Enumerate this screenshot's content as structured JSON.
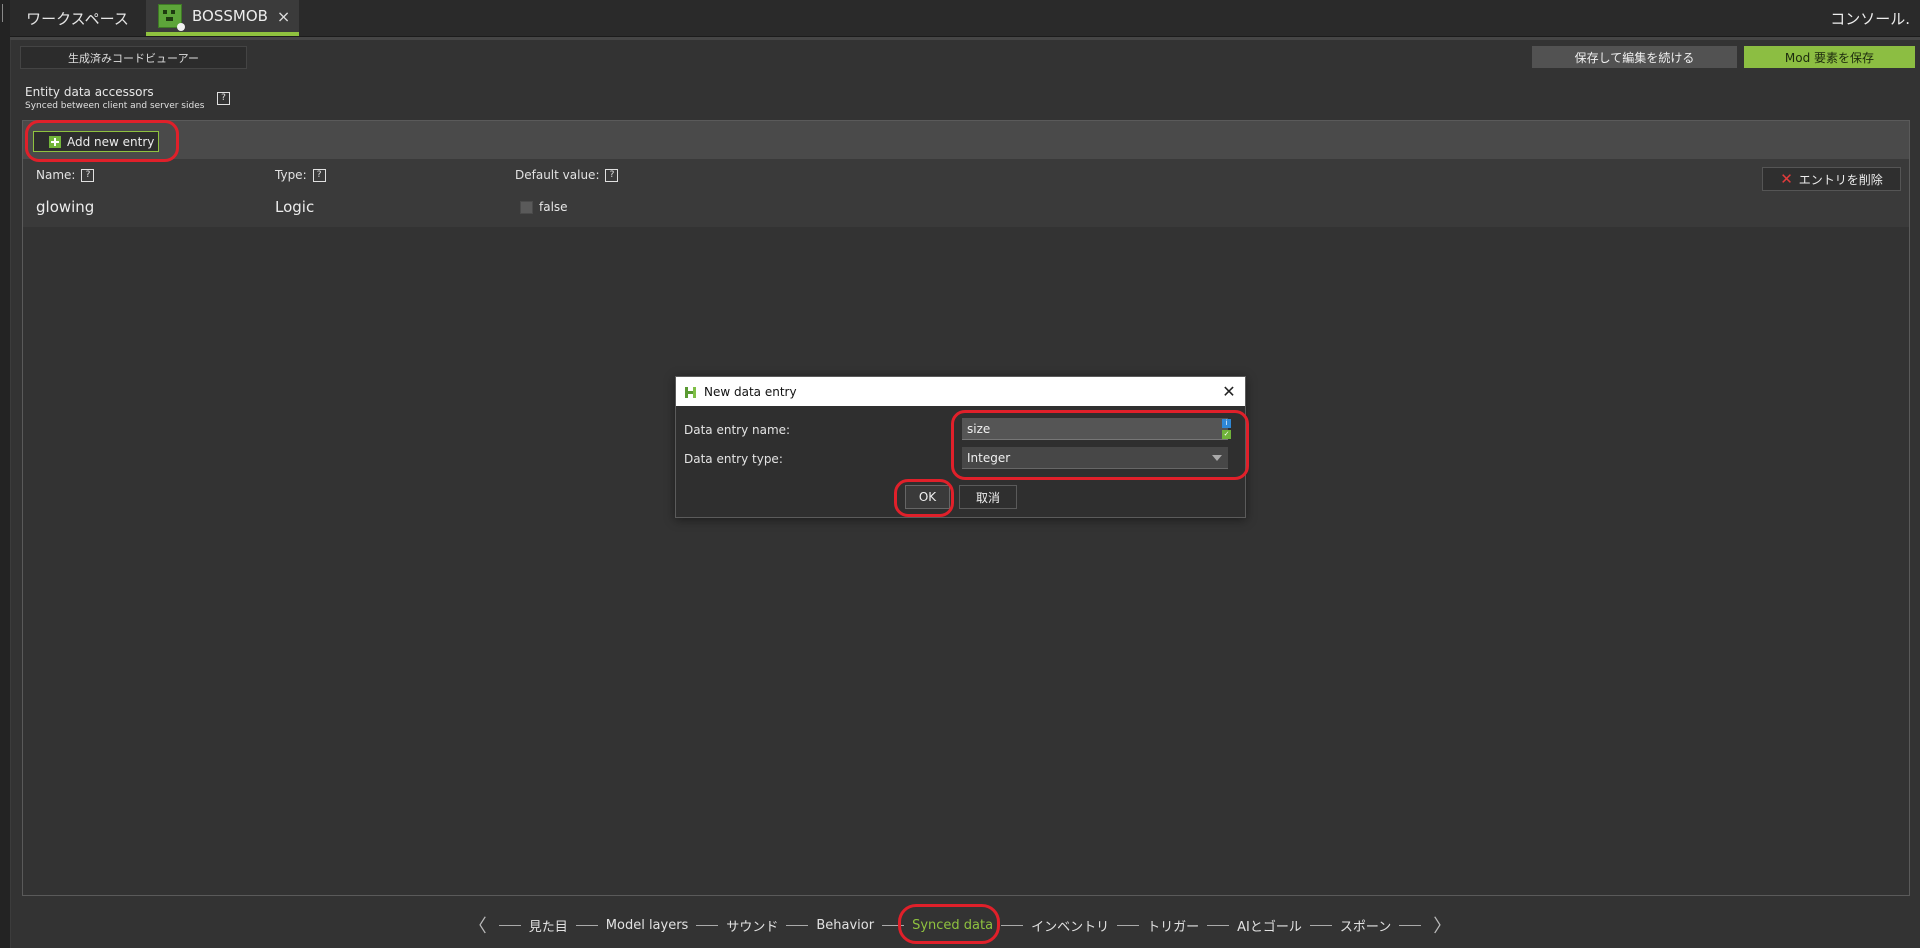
{
  "tabs": {
    "workspace_label": "ワークスペース",
    "mod_tab_label": "BOSSMOB",
    "close_glyph": "×",
    "console_label": "コンソール."
  },
  "toolbar": {
    "code_viewer_label": "生成済みコードビューアー",
    "save_continue_label": "保存して編集を続ける",
    "save_mod_label": "Mod 要素を保存"
  },
  "section": {
    "title": "Entity data accessors",
    "subtitle": "Synced between client and server sides",
    "help_glyph": "?"
  },
  "panel": {
    "add_entry_label": "Add new entry",
    "headers": {
      "name": "Name:",
      "type": "Type:",
      "default": "Default value:"
    },
    "entry": {
      "name": "glowing",
      "type": "Logic",
      "default_value": "false"
    },
    "delete_label": "エントリを削除"
  },
  "dialog": {
    "title": "New data entry",
    "name_label": "Data entry name:",
    "name_value": "size",
    "type_label": "Data entry type:",
    "type_value": "Integer",
    "ok_label": "OK",
    "cancel_label": "取消"
  },
  "nav": {
    "items": [
      "見た目",
      "Model layers",
      "サウンド",
      "Behavior",
      "Synced data",
      "インベントリ",
      "トリガー",
      "AIとゴール",
      "スポーン"
    ],
    "active": "Synced data",
    "prev_glyph": "〈",
    "next_glyph": "〉"
  },
  "colors": {
    "accent": "#8fc23f",
    "highlight": "#e0202a",
    "background": "#333333"
  }
}
